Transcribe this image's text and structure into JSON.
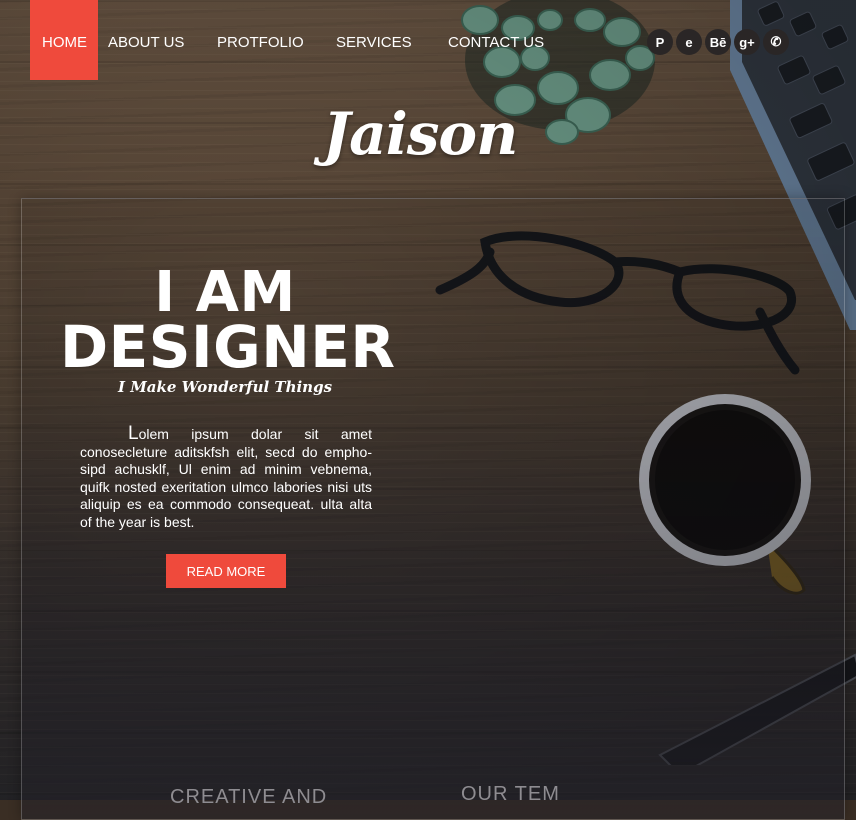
{
  "nav": {
    "items": [
      {
        "label": "HOME",
        "active": true
      },
      {
        "label": "ABOUT US"
      },
      {
        "label": "PROTFOLIO"
      },
      {
        "label": "SERVICES"
      },
      {
        "label": "CONTACT US"
      }
    ]
  },
  "social": [
    {
      "icon": "pinterest-icon",
      "glyph": "P"
    },
    {
      "icon": "internet-explorer-icon",
      "glyph": "e"
    },
    {
      "icon": "behance-icon",
      "glyph": "Bē"
    },
    {
      "icon": "google-plus-icon",
      "glyph": "g+"
    },
    {
      "icon": "phone-icon",
      "glyph": "✆"
    }
  ],
  "logo": "Jaison",
  "hero": {
    "title_line1": "I AM",
    "title_line2": "DESIGNER",
    "tagline": "I Make Wonderful Things",
    "body": "Lolem ipsum dolar sit amet conosecleture aditskfsh elit, secd do empho-sipd achusklf, Ul enim ad minim vebnema, quifk nosted exeritation ulmco labories nisi uts aliquip es ea commodo consequeat. ulta alta of the year is best.",
    "button": "READ MORE"
  },
  "sections": {
    "left_heading": "CREATIVE AND",
    "right_heading": "OUR TEM"
  },
  "colors": {
    "accent": "#ef4a3c"
  }
}
